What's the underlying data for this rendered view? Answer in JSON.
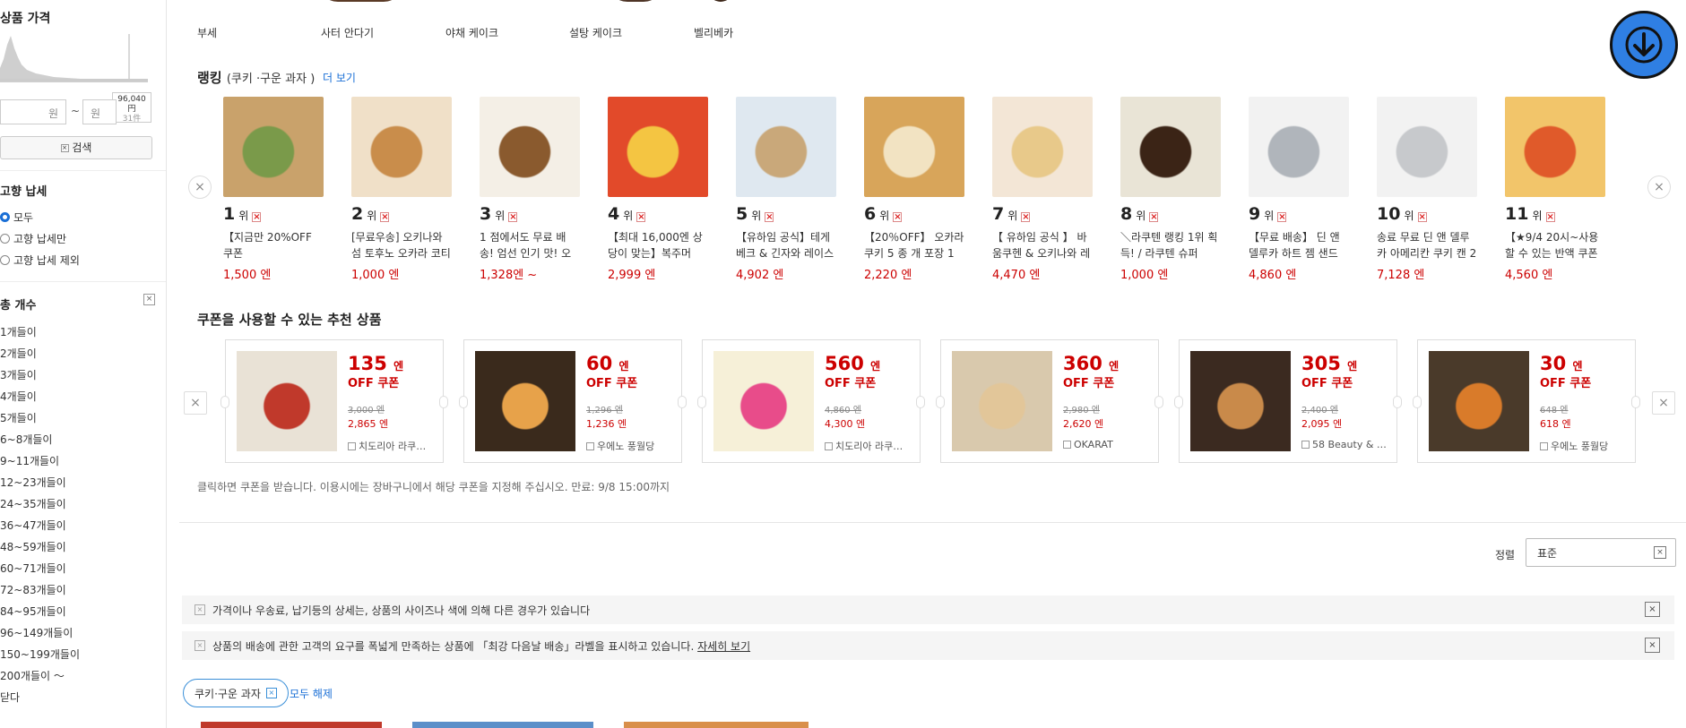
{
  "sidebar": {
    "price_heading": "상품 가격",
    "price_tooltip": [
      "96,040",
      "円",
      "31件"
    ],
    "min_placeholder": "원",
    "max_placeholder": "원",
    "tilde": "~",
    "search_label": "검색",
    "furusato_heading": "고향 납세",
    "furusato_options": [
      {
        "label": "모두",
        "selected": true
      },
      {
        "label": "고향 납세만",
        "selected": false
      },
      {
        "label": "고향 납세 제외",
        "selected": false
      }
    ],
    "count_heading": "총 개수",
    "count_items": [
      "1개들이",
      "2개들이",
      "3개들이",
      "4개들이",
      "5개들이",
      "6~8개들이",
      "9~11개들이",
      "12~23개들이",
      "24~35개들이",
      "36~47개들이",
      "48~59개들이",
      "60~71개들이",
      "72~83개들이",
      "84~95개들이",
      "96~149개들이",
      "150~199개들이",
      "200개들이 〜",
      "닫다"
    ]
  },
  "categories": [
    "부세",
    "사터 안다기",
    "야채 케이크",
    "설탕 케이크",
    "벨리베카"
  ],
  "ranking": {
    "title": "랭킹",
    "subtitle": "(쿠키 ·구운 과자 )",
    "more": "더 보기",
    "rank_suffix": "위",
    "items": [
      {
        "rank": "1",
        "name": "【지금만 20%OFF 쿠폰",
        "price": "1,500 엔"
      },
      {
        "rank": "2",
        "name": "[무료우송] 오키나와 섬 토후노 오카라 코티 …",
        "price": "1,000 엔"
      },
      {
        "rank": "3",
        "name": "1 점에서도 무료 배송! 엄선 인기 맛! 오카라…",
        "price": "1,328엔 ~"
      },
      {
        "rank": "4",
        "name": "【최대 16,000엔 상당이 맞는】복주머니…",
        "price": "2,999 엔"
      },
      {
        "rank": "5",
        "name": "【유하임 공식】테게베크 & 긴자와 레이스점…",
        "price": "4,902 엔"
      },
      {
        "rank": "6",
        "name": "【20％OFF】 오카라 쿠키 5 종 개 포장 1 k…",
        "price": "2,220 엔"
      },
      {
        "rank": "7",
        "name": "【 유하임 공식 】 바움쿠헨 & 오키나와 레이…",
        "price": "4,470 엔"
      },
      {
        "rank": "8",
        "name": "＼라쿠텐 랭킹 1위 획득! / 라쿠텐 슈퍼 SA…",
        "price": "1,000 엔"
      },
      {
        "rank": "9",
        "name": "【무료 배송】 딘 앤 델루카 하트 젬 샌드 쿠…",
        "price": "4,860 엔"
      },
      {
        "rank": "10",
        "name": "송료 무료 딘 앤 델루카 아메리칸 쿠키 캔 2 …",
        "price": "7,128 엔"
      },
      {
        "rank": "11",
        "name": "【★9/4 20시~사용할 수 있는 반액 쿠폰 배…",
        "price": "4,560 엔"
      }
    ]
  },
  "coupons": {
    "title": "쿠폰을 사용할 수 있는 추천 상품",
    "unit": "엔",
    "off_label": "OFF 쿠폰",
    "items": [
      {
        "amount": "135",
        "old": "3,000 엔",
        "new": "2,865 엔",
        "store": "치도리아 라쿠…"
      },
      {
        "amount": "60",
        "old": "1,296 엔",
        "new": "1,236 엔",
        "store": "우에노 풍월당"
      },
      {
        "amount": "560",
        "old": "4,860 엔",
        "new": "4,300 엔",
        "store": "치도리아 라쿠…"
      },
      {
        "amount": "360",
        "old": "2,980 엔",
        "new": "2,620 엔",
        "store": "OKARAT"
      },
      {
        "amount": "305",
        "old": "2,400 엔",
        "new": "2,095 엔",
        "store": "58 Beauty & …"
      },
      {
        "amount": "30",
        "old": "648 엔",
        "new": "618 엔",
        "store": "우에노 풍월당"
      }
    ],
    "note": "클릭하면 쿠폰을 받습니다. 이용시에는 장바구니에서 해당 쿠폰을 지정해 주십시오. 만료: 9/8 15:00까지"
  },
  "sort": {
    "label": "정렬",
    "value": "표준"
  },
  "notices": [
    {
      "text": "가격이나 우송료, 납기등의 상세는, 상품의 사이즈나 색에 의해 다른 경우가 있습니다",
      "link": ""
    },
    {
      "text": "상품의 배송에 관한 고객의 요구를 폭넓게 만족하는 상품에 「최강 다음날 배송」라벨을 표시하고 있습니다.",
      "link": "자세히 보기"
    }
  ],
  "filter_chip": "쿠키·구운 과자",
  "clear_all": "모두 해제",
  "colors": {
    "accent_blue": "#2f7fe3",
    "price_red": "#cc0000",
    "link_blue": "#1a6fd6"
  }
}
